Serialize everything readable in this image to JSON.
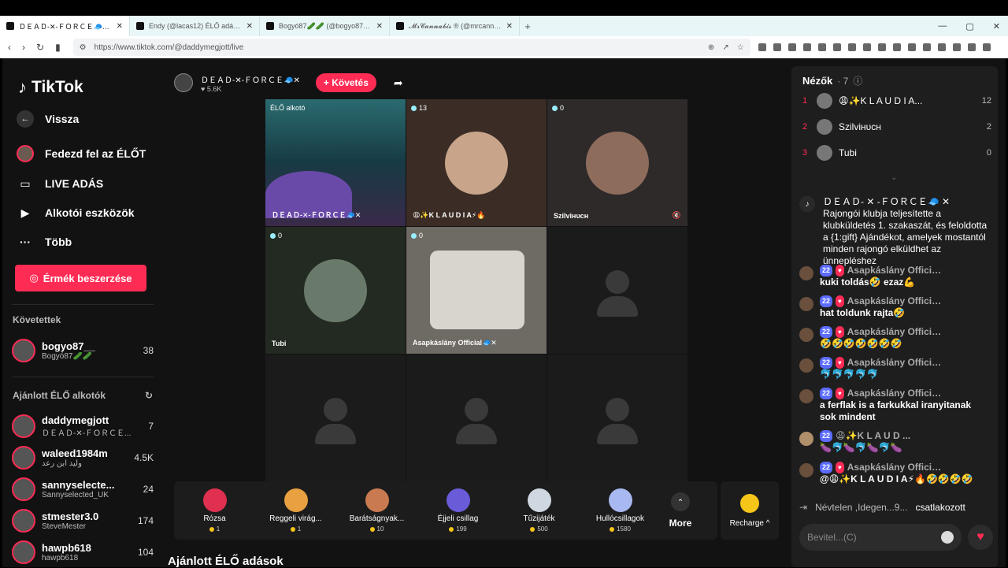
{
  "browser": {
    "tabs": [
      {
        "title": "ＤＥＡＤ-✕-ＦＯＲＣＥ🧢✕ (@d"
      },
      {
        "title": "Endy (@lacas12) ÉLŐ adásban va"
      },
      {
        "title": "Bogyó87🥒🥒 (@bogyo87_) ÉLŐ a"
      },
      {
        "title": "𝓜𝓻𝓒𝓪𝓷𝓷𝓪𝓫𝓲𝓼 ® (@mrcannabis_)"
      }
    ],
    "url": "https://www.tiktok.com/@daddymegjott/live"
  },
  "sidebar": {
    "logo": "TikTok",
    "back": "Vissza",
    "items": [
      {
        "label": "Fedezd fel az ÉLŐT"
      },
      {
        "label": "LIVE ADÁS"
      },
      {
        "label": "Alkotói eszközök"
      },
      {
        "label": "Több"
      }
    ],
    "coins_button": "Érmék beszerzése",
    "following_title": "Követettek",
    "following": [
      {
        "name": "bogyo87__",
        "sub": "Bogyó87🥒🥒",
        "count": "38"
      }
    ],
    "suggested_title": "Ajánlott ÉLŐ alkotók",
    "suggested": [
      {
        "name": "daddymegjott",
        "sub": "ＤＥＡＤ-✕-ＦＯＲＣＥ...",
        "count": "7"
      },
      {
        "name": "waleed1984m",
        "sub": "وليد ابن رعد",
        "count": "4.5K"
      },
      {
        "name": "sannyselecte...",
        "sub": "Sannyselected_UK",
        "count": "24"
      },
      {
        "name": "stmester3.0",
        "sub": "SteveMester",
        "count": "174"
      },
      {
        "name": "hawpb618",
        "sub": "hawpb618",
        "count": "104"
      }
    ]
  },
  "stream": {
    "host": "ＤＥＡＤ-✕-ＦＯＲＣＥ🧢✕",
    "likes": "♥ 5.6K",
    "follow_button": "+ Követés",
    "cells": [
      {
        "badge": "ÉLŐ alkotó",
        "label": "ＤＥＡＤ-✕-ＦＯＲＣＥ🧢✕",
        "type": "host"
      },
      {
        "badge": "13",
        "label": "😩✨K L A U D I A⚡🔥",
        "type": "face"
      },
      {
        "badge": "0",
        "label": "Szilviʜᴜᴄʜ",
        "type": "face"
      },
      {
        "badge": "0",
        "label": "Tubi",
        "type": "face"
      },
      {
        "badge": "0",
        "label": "Asapkáslány Official🧢✕",
        "type": "video"
      },
      {
        "badge": "",
        "label": "",
        "type": "empty"
      },
      {
        "badge": "",
        "label": "",
        "type": "empty"
      },
      {
        "badge": "",
        "label": "",
        "type": "empty"
      },
      {
        "badge": "",
        "label": "",
        "type": "empty"
      }
    ],
    "gifts": [
      {
        "name": "Rózsa",
        "price": "1"
      },
      {
        "name": "Reggeli virág...",
        "price": "1"
      },
      {
        "name": "Barátságnyak...",
        "price": "10"
      },
      {
        "name": "Éjjeli csillag",
        "price": "199"
      },
      {
        "name": "Tűzijáték",
        "price": "500"
      },
      {
        "name": "Hullócsillagok",
        "price": "1580"
      }
    ],
    "more": "More",
    "recharge": "Recharge ^",
    "recommended_title": "Ajánlott ÉLŐ adások"
  },
  "chat": {
    "viewers_title": "Nézők",
    "viewers_count": "· 7",
    "viewers": [
      {
        "rank": "1",
        "name": "😩✨K L A U D I A...",
        "score": "12"
      },
      {
        "rank": "2",
        "name": "Szilviʜᴜᴄʜ",
        "score": "2"
      },
      {
        "rank": "3",
        "name": "Tubi",
        "score": "0"
      }
    ],
    "system_message": "ＤＥＡＤ- ✕ -ＦＯＲＣＥ🧢 ✕ Rajongói klubja teljesítette a klubküldetés 1. szakaszát, és feloldotta a {1:gift} Ajándékot, amelyek mostantól minden rajongó elküldhet az ünnepléshez",
    "messages": [
      {
        "level": "22",
        "user": "Asapkáslány Official...",
        "text": "kuki toldás🤣 ezaz💪"
      },
      {
        "level": "22",
        "user": "Asapkáslány Official...",
        "text": "hat toldunk rajta🤣"
      },
      {
        "level": "22",
        "user": "Asapkáslány Official...",
        "text": "🤣🤣🤣🤣🤣🤣🤣"
      },
      {
        "level": "22",
        "user": "Asapkáslány Official...",
        "text": "🐬🐬🐬🐬🐬"
      },
      {
        "level": "22",
        "user": "Asapkáslány Official...",
        "text": "a ferflak is a farkukkal iranyitanak sok mindent"
      },
      {
        "level": "22",
        "user": "😩✨K L A U D ...",
        "text": "🍆🐬🍆🐬🍆🐬🍆"
      },
      {
        "level": "22",
        "user": "Asapkáslány Official...",
        "text": "@😩✨K L A U D I A⚡🔥🤣🤣🤣🤣"
      }
    ],
    "join_user": "Névtelen ,Idegen...9...",
    "join_text": "csatlakozott",
    "input_placeholder": "Bevitel...(C)"
  }
}
